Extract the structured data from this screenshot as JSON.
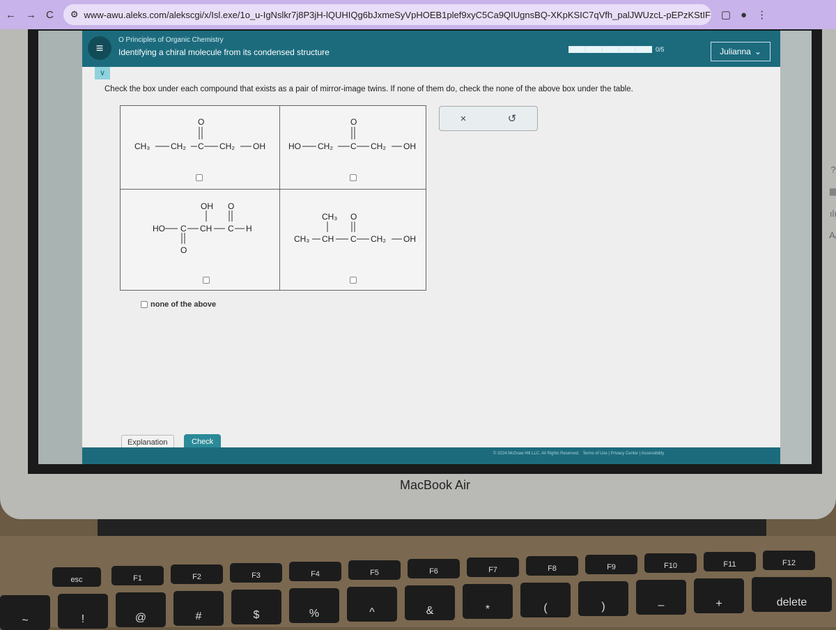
{
  "browser": {
    "url": "www-awu.aleks.com/alekscgi/x/Isl.exe/1o_u-IgNslkr7j8P3jH-lQUHIQg6bJxmeSyVpHOEB1plef9xyC5Ca9QIUgnsBQ-XKpKSIC7qVfh_palJWUzcL-pEPzKStIF-d1GrOl6p5...",
    "back": "←",
    "forward": "→",
    "reload": "C",
    "star": "☆",
    "menu": "⋮"
  },
  "header": {
    "course": "O Principles of Organic Chemistry",
    "topic": "Identifying a chiral molecule from its condensed structure",
    "progress": "0/5",
    "progress_value": 0,
    "progress_total": 5,
    "user": "Julianna",
    "menu_icon": "≡"
  },
  "prompt": "Check the box under each compound that exists as a pair of mirror-image twins. If none of them do, check the none of the above box under the table.",
  "compounds": [
    {
      "atoms": [
        "CH₃",
        "CH₂",
        "C",
        "O",
        "CH₂",
        "OH"
      ],
      "checked": false
    },
    {
      "atoms": [
        "HO",
        "CH₂",
        "C",
        "O",
        "CH₂",
        "OH"
      ],
      "checked": false
    },
    {
      "atoms": [
        "HO",
        "C",
        "O",
        "CH",
        "OH",
        "C",
        "O",
        "H"
      ],
      "checked": false
    },
    {
      "atoms": [
        "CH₃",
        "CH",
        "CH₃",
        "C",
        "O",
        "CH₂",
        "OH"
      ],
      "checked": false
    }
  ],
  "none_label": "none of the above",
  "actions": {
    "clear": "×",
    "undo": "↺"
  },
  "buttons": {
    "explanation": "Explanation",
    "check": "Check"
  },
  "footer": {
    "copyright": "© 2024 McGraw Hill LLC. All Rights Reserved.",
    "terms": "Terms of Use",
    "privacy": "Privacy Center",
    "accessibility": "Accessibility"
  },
  "tools": [
    "?",
    "▦",
    "ılı",
    "Aᵣ"
  ],
  "laptop": {
    "brand": "MacBook Air"
  },
  "keys": {
    "fn": [
      "esc",
      "F1",
      "F2",
      "F3",
      "F4",
      "F5",
      "F6",
      "F7",
      "F8",
      "F9",
      "F10",
      "F11",
      "F12"
    ],
    "num": [
      "~",
      "!",
      "@",
      "#",
      "$",
      "%",
      "^",
      "&",
      "*",
      "(",
      ")",
      "–",
      "+",
      "delete"
    ]
  },
  "colors": {
    "header": "#1c6b7d",
    "check_button": "#2b8a98",
    "browser_bar": "#c8b3ea"
  }
}
